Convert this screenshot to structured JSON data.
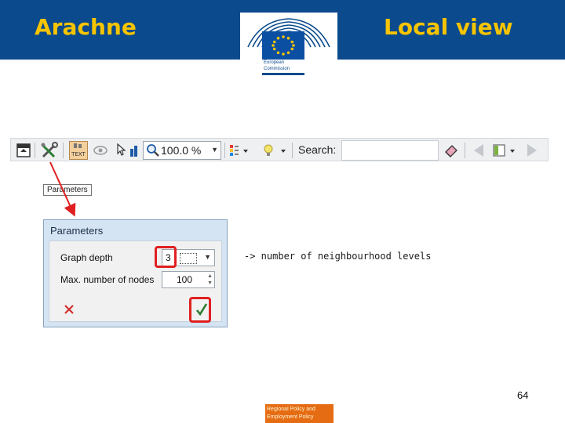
{
  "header": {
    "title_left": "Arachne",
    "title_right": "Local view",
    "logo_text_line1": "European",
    "logo_text_line2": "Commission",
    "bg_color": "#0b4a8c",
    "title_color": "#f6c400"
  },
  "toolbar": {
    "text_button_label": "TEXT",
    "zoom_value": "100.0 %",
    "search_label": "Search:",
    "search_value": "",
    "icons": [
      "window-icon",
      "tools-parameters-icon",
      "text-mode-icon",
      "eye-icon",
      "cursor-icon",
      "chart-icon",
      "zoom-icon",
      "zoom-dropdown-icon",
      "color-legend-icon",
      "lightbulb-icon",
      "eraser-icon",
      "back-arrow-icon",
      "panel-icon",
      "forward-arrow-icon"
    ]
  },
  "tooltip": {
    "text": "Parameters"
  },
  "dialog": {
    "title": "Parameters",
    "graph_depth_label": "Graph depth",
    "graph_depth_value": "3",
    "max_nodes_label": "Max. number of nodes",
    "max_nodes_value": "100"
  },
  "annotation": {
    "note": "-> number of neighbourhood levels"
  },
  "highlight_color": "#e02020",
  "footer": {
    "page_number": "64",
    "badge_line1": "Regional Policy and",
    "badge_line2": "Employment Policy",
    "badge_color": "#e56c12"
  }
}
